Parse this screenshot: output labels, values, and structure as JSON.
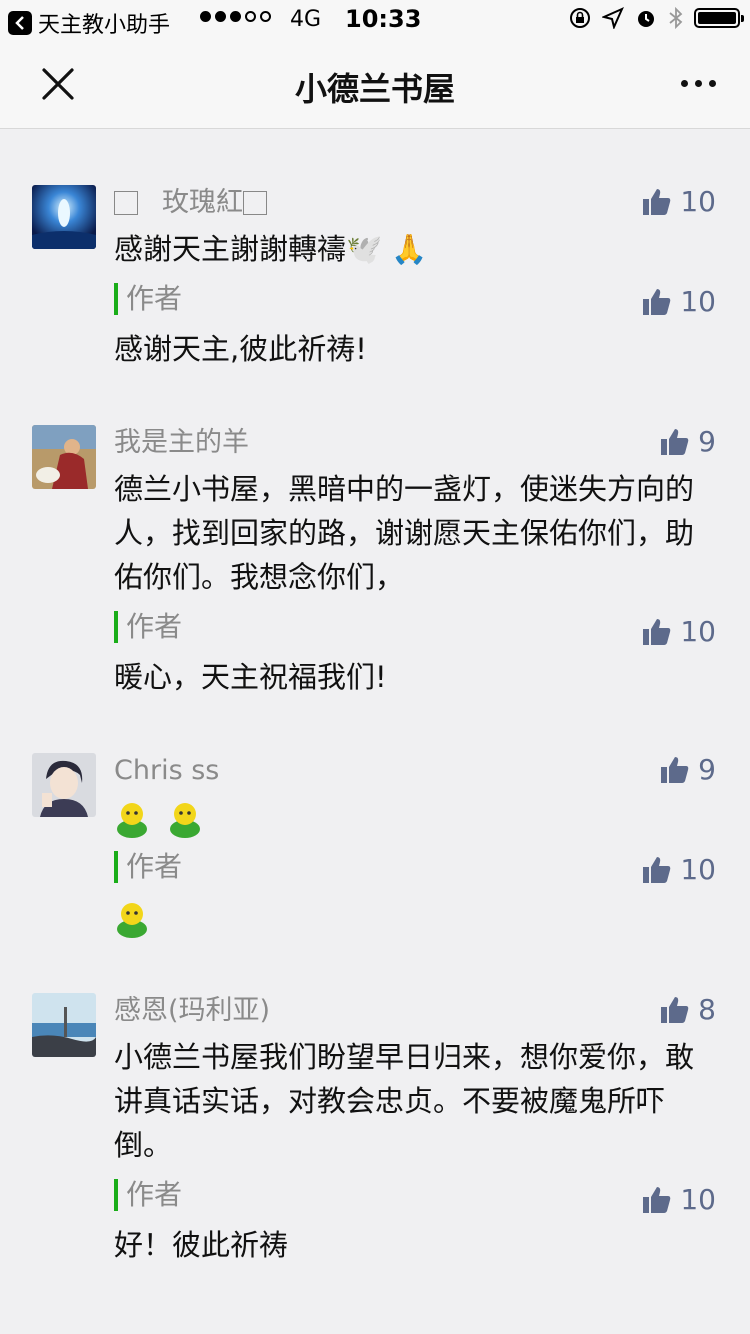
{
  "status_bar": {
    "back_app": "天主教小助手",
    "network": "4G",
    "time": "10:33"
  },
  "nav": {
    "title": "小德兰书屋"
  },
  "comments": [
    {
      "name": "玫瑰紅",
      "likes": "10",
      "text": "感謝天主謝謝轉禱🕊️ 🙏",
      "reply_label": "作者",
      "reply_likes": "10",
      "reply_text": "感谢天主,彼此祈祷!"
    },
    {
      "name": "我是主的羊",
      "likes": "9",
      "text": "德兰小书屋，黑暗中的一盏灯，使迷失方向的人，找到回家的路，谢谢愿天主保佑你们，助佑你们。我想念你们，",
      "reply_label": "作者",
      "reply_likes": "10",
      "reply_text": "暖心，天主祝福我们!"
    },
    {
      "name": "Chris ss",
      "likes": "9",
      "text": "",
      "reply_label": "作者",
      "reply_likes": "10",
      "reply_text": ""
    },
    {
      "name": "感恩(玛利亚)",
      "likes": "8",
      "text": "小德兰书屋我们盼望早日归来，想你爱你，敢讲真话实话，对教会忠贞。不要被魔鬼所吓倒。",
      "reply_label": "作者",
      "reply_likes": "10",
      "reply_text": "好！彼此祈祷"
    }
  ],
  "colors": {
    "accent_green": "#1aad19",
    "like_blue": "#5d6a8b",
    "background": "#f0f0f2"
  }
}
